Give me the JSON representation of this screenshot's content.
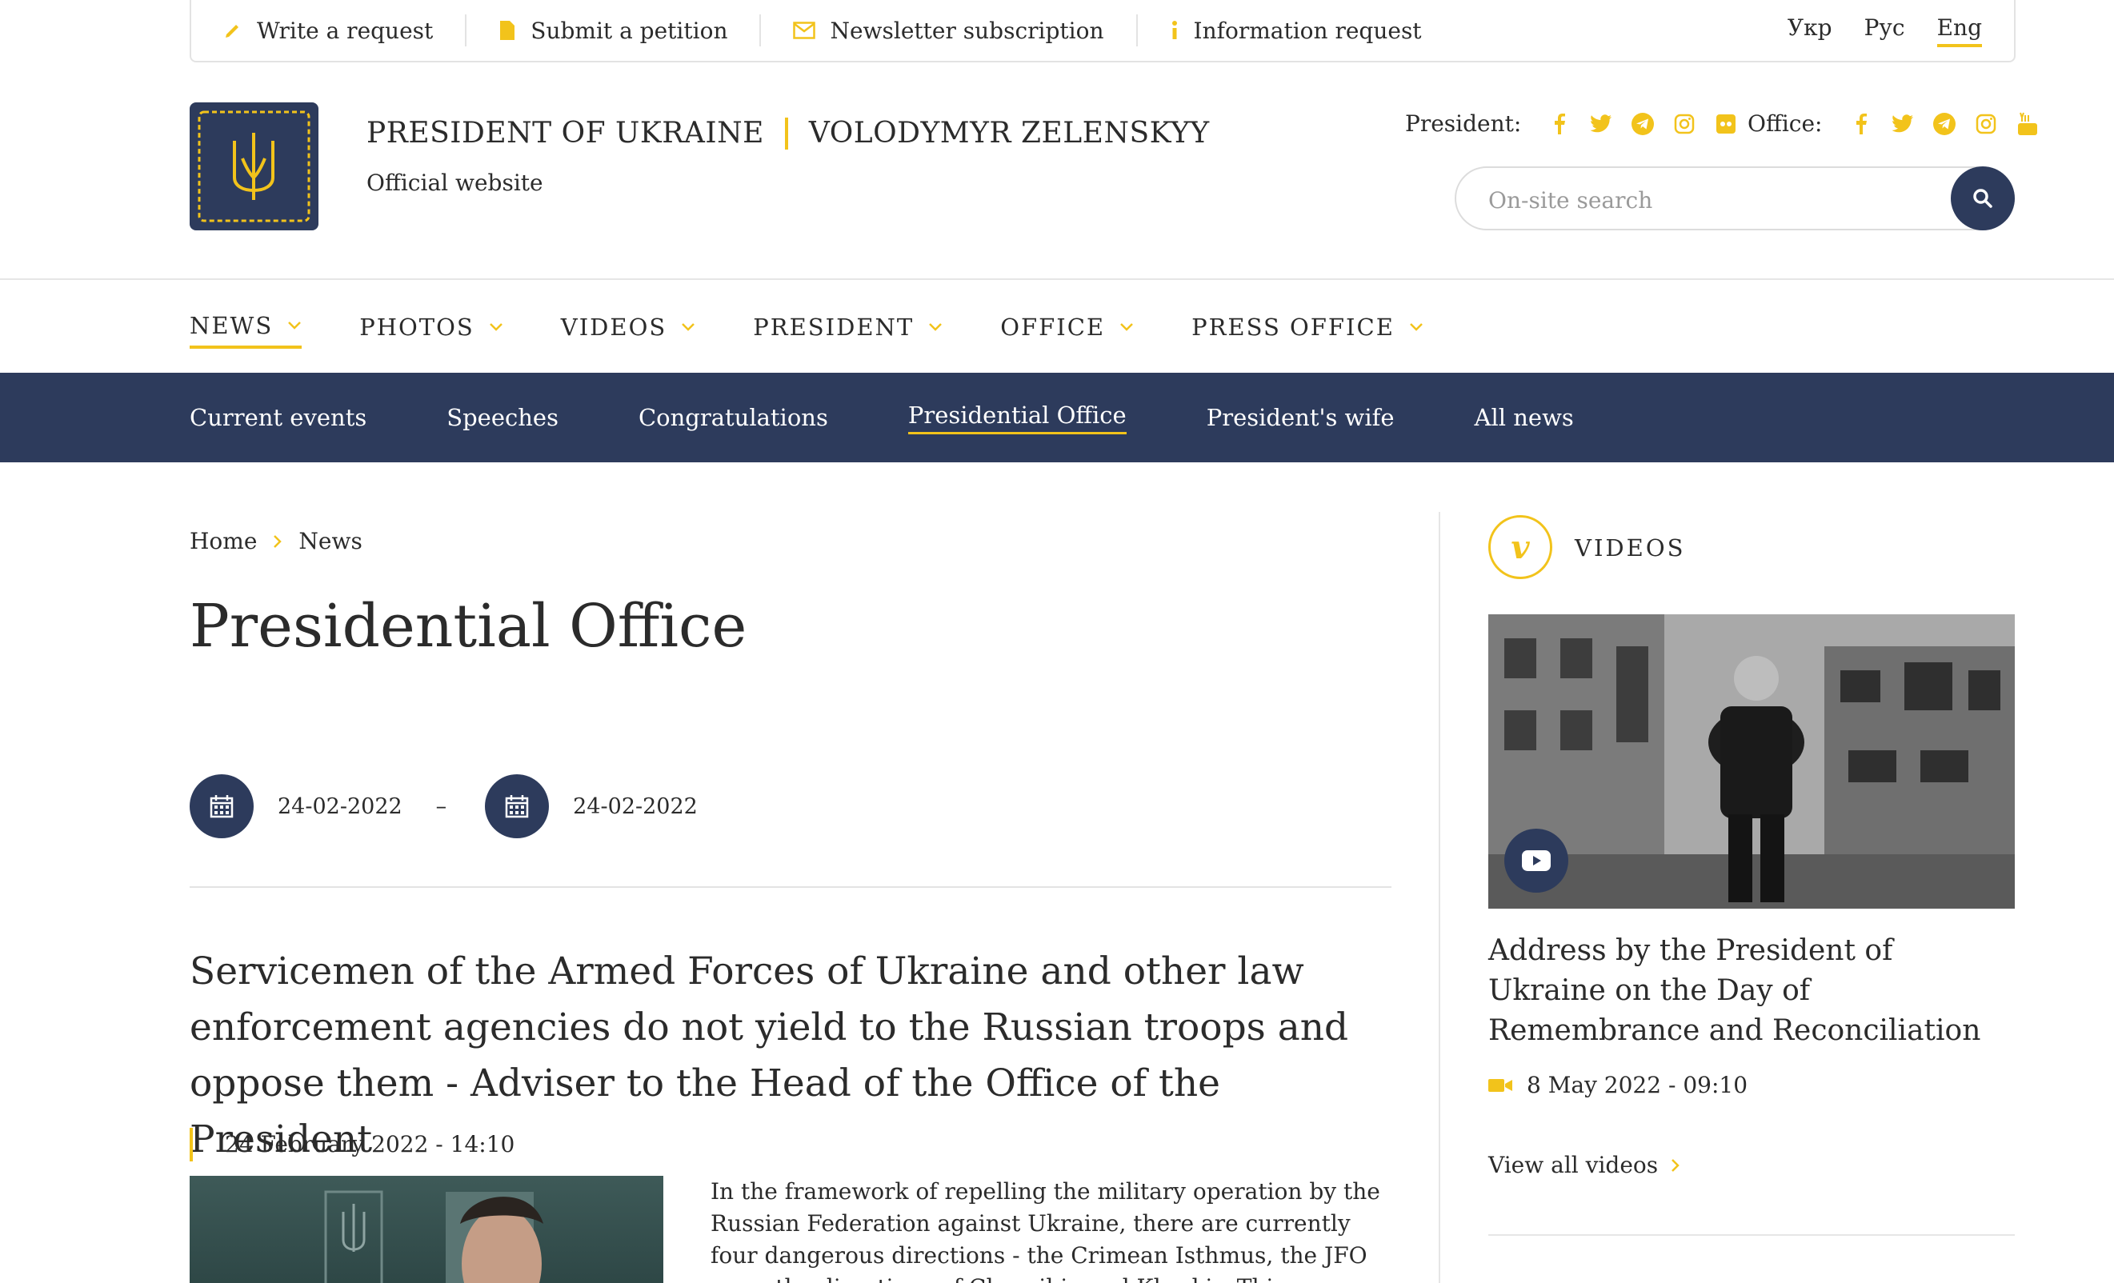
{
  "topbar": {
    "items": [
      "Write a request",
      "Submit a petition",
      "Newsletter subscription",
      "Information request"
    ],
    "languages": [
      "Укр",
      "Рус",
      "Eng"
    ],
    "active_language": "Eng"
  },
  "header": {
    "title_left": "PRESIDENT OF UKRAINE",
    "title_right": "VOLODYMYR ZELENSKYY",
    "subtitle": "Official website",
    "president_label": "President:",
    "office_label": "Office:",
    "search_placeholder": "On-site search"
  },
  "mainnav": {
    "items": [
      "NEWS",
      "PHOTOS",
      "VIDEOS",
      "PRESIDENT",
      "OFFICE",
      "PRESS OFFICE"
    ],
    "active": "NEWS"
  },
  "subnav": {
    "items": [
      "Current events",
      "Speeches",
      "Congratulations",
      "Presidential Office",
      "President's wife",
      "All news"
    ],
    "active": "Presidential Office"
  },
  "breadcrumb": {
    "home": "Home",
    "current": "News"
  },
  "page": {
    "title": "Presidential Office",
    "date_from": "24-02-2022",
    "date_sep": "–",
    "date_to": "24-02-2022"
  },
  "article": {
    "title": "Servicemen of the Armed Forces of Ukraine and other law enforcement agencies do not yield to the Russian troops and oppose them - Adviser to the Head of the Office of the President",
    "date": "24 February 2022 - 14:10",
    "text": "In the framework of repelling the military operation by the Russian Federation against Ukraine, there are currently four dangerous directions - the Crimean Isthmus, the JFO area, the directions of Chernihiv and Kharkiv. This was reported by Adviser to the Head"
  },
  "sidebar": {
    "section_label": "VIDEOS",
    "badge_letter": "v",
    "video_title": "Address by the President of Ukraine on the Day of Remembrance and Reconciliation",
    "video_date": "8 May 2022 - 09:10",
    "view_all": "View all videos"
  },
  "colors": {
    "accent": "#f2c31b",
    "navy": "#2d3b5c"
  }
}
